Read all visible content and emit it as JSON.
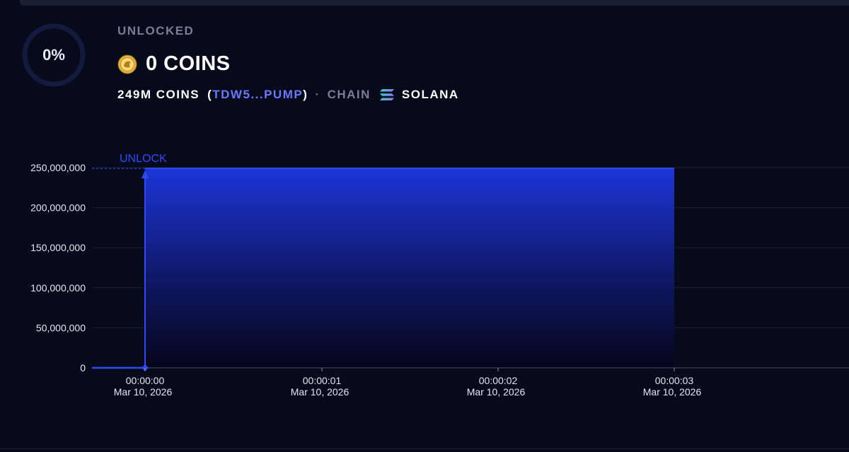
{
  "header": {
    "progress": "0%",
    "progress_fraction": 0,
    "status": "UNLOCKED",
    "amount": "0 COINS",
    "coin_icon": "coin-icon",
    "total": "249M COINS",
    "address_open": "(",
    "address": "TDW5...PUMP",
    "address_close": ")",
    "separator": "·",
    "chain_label": "CHAIN",
    "chain_icon": "solana-icon",
    "chain_name": "SOLANA"
  },
  "colors": {
    "accent": "#2f49ff",
    "address": "#6b78ff",
    "background": "#070a1a"
  },
  "chart_data": {
    "type": "area",
    "annotation": "UNLOCK",
    "x": [
      "00:00:00",
      "00:00:01",
      "00:00:02",
      "00:00:03"
    ],
    "x_ticks": [
      {
        "time": "00:00:00",
        "date": "Mar 10, 2026"
      },
      {
        "time": "00:00:01",
        "date": "Mar 10, 2026"
      },
      {
        "time": "00:00:02",
        "date": "Mar 10, 2026"
      },
      {
        "time": "00:00:03",
        "date": "Mar 10, 2026"
      }
    ],
    "y_ticks": [
      "0",
      "50,000,000",
      "100,000,000",
      "150,000,000",
      "200,000,000",
      "250,000,000"
    ],
    "y_tick_values": [
      0,
      50000000,
      100000000,
      150000000,
      200000000,
      250000000
    ],
    "ylim": [
      0,
      250000000
    ],
    "unlock_value": 249000000,
    "series": [
      {
        "values": [
          249000000,
          249000000,
          249000000,
          249000000
        ]
      }
    ],
    "grid": true
  }
}
